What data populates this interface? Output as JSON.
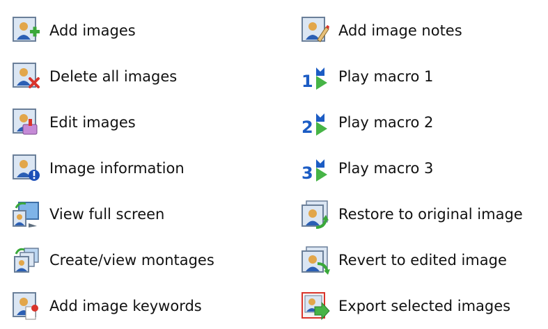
{
  "left_items": [
    {
      "label": "Add images",
      "icon": "add-images-icon"
    },
    {
      "label": "Delete all images",
      "icon": "delete-all-images-icon"
    },
    {
      "label": "Edit images",
      "icon": "edit-images-icon"
    },
    {
      "label": "Image information",
      "icon": "image-information-icon"
    },
    {
      "label": "View full screen",
      "icon": "view-full-screen-icon"
    },
    {
      "label": "Create/view montages",
      "icon": "create-view-montages-icon"
    },
    {
      "label": "Add image keywords",
      "icon": "add-image-keywords-icon"
    }
  ],
  "right_items": [
    {
      "label": "Add image notes",
      "icon": "add-image-notes-icon"
    },
    {
      "label": "Play macro 1",
      "icon": "play-macro-1-icon",
      "digit": "1"
    },
    {
      "label": "Play macro 2",
      "icon": "play-macro-2-icon",
      "digit": "2"
    },
    {
      "label": "Play macro 3",
      "icon": "play-macro-3-icon",
      "digit": "3"
    },
    {
      "label": "Restore to original image",
      "icon": "restore-original-image-icon"
    },
    {
      "label": "Revert to edited image",
      "icon": "revert-edited-image-icon"
    },
    {
      "label": "Export selected images",
      "icon": "export-selected-images-icon"
    }
  ],
  "colors": {
    "frame": "#6a7f99",
    "frame_fill": "#dbe6f3",
    "person_skin": "#e2a64a",
    "person_body": "#2b5fb4",
    "plus_green": "#3aa83a",
    "delete_red": "#d9342b",
    "info_blue": "#1d4fb8",
    "macro_blue": "#1c5cc4",
    "play_green": "#46b446"
  }
}
